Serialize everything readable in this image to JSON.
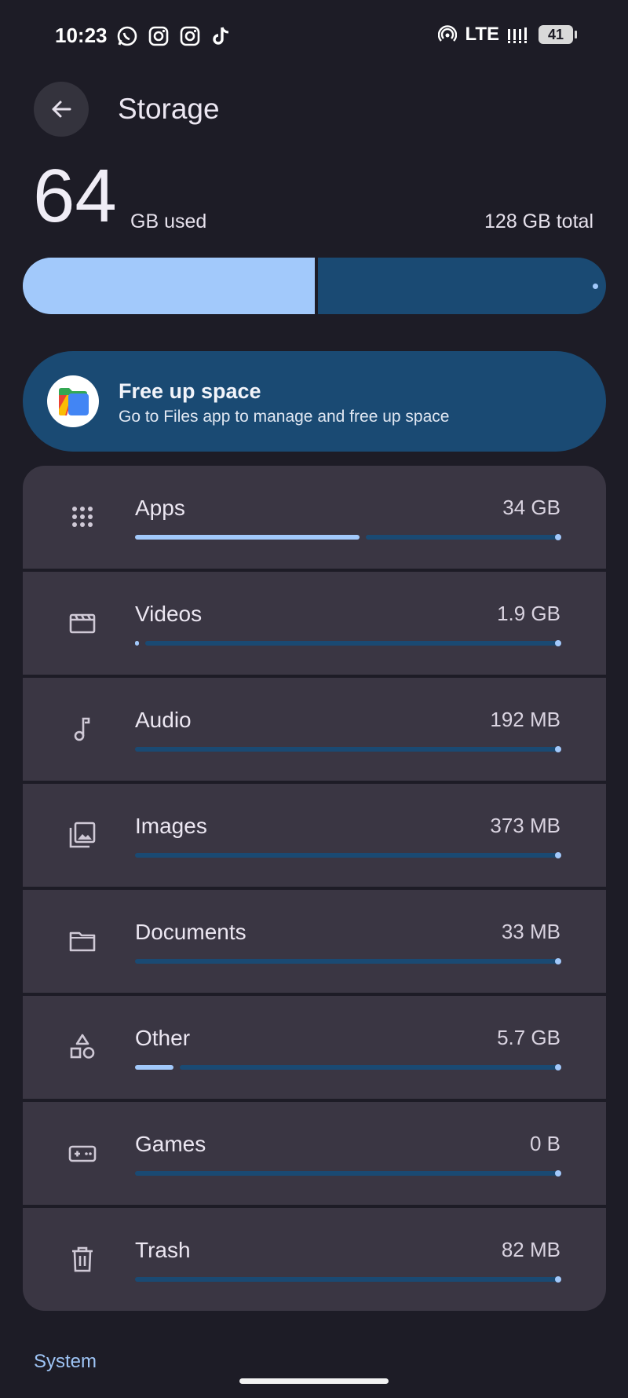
{
  "status_bar": {
    "time": "10:23",
    "network": "LTE",
    "battery": "41",
    "notif_icons": [
      "whatsapp-icon",
      "instagram-icon",
      "instagram-icon",
      "tiktok-icon"
    ]
  },
  "header": {
    "title": "Storage",
    "back_icon": "arrow-left-icon"
  },
  "usage": {
    "used_value": "64",
    "used_unit": "GB used",
    "total": "128 GB total",
    "used_fraction": 0.5
  },
  "free_up": {
    "title": "Free up space",
    "subtitle": "Go to Files app to manage and free up space",
    "icon": "files-app-icon"
  },
  "categories": [
    {
      "label": "Apps",
      "size": "34 GB",
      "icon": "apps-grid-icon",
      "fraction": 0.53
    },
    {
      "label": "Videos",
      "size": "1.9 GB",
      "icon": "video-clapper-icon",
      "fraction": 0.01
    },
    {
      "label": "Audio",
      "size": "192 MB",
      "icon": "music-note-icon",
      "fraction": 0
    },
    {
      "label": "Images",
      "size": "373 MB",
      "icon": "images-icon",
      "fraction": 0
    },
    {
      "label": "Documents",
      "size": "33 MB",
      "icon": "folder-icon",
      "fraction": 0
    },
    {
      "label": "Other",
      "size": "5.7 GB",
      "icon": "shapes-icon",
      "fraction": 0.09
    },
    {
      "label": "Games",
      "size": "0 B",
      "icon": "gamepad-icon",
      "fraction": 0
    },
    {
      "label": "Trash",
      "size": "82 MB",
      "icon": "trash-icon",
      "fraction": 0
    }
  ],
  "footer": {
    "section": "System"
  },
  "colors": {
    "accent": "#a2c9fb",
    "track": "#1a4a73",
    "background": "#1d1c26",
    "card": "#3a3643"
  }
}
